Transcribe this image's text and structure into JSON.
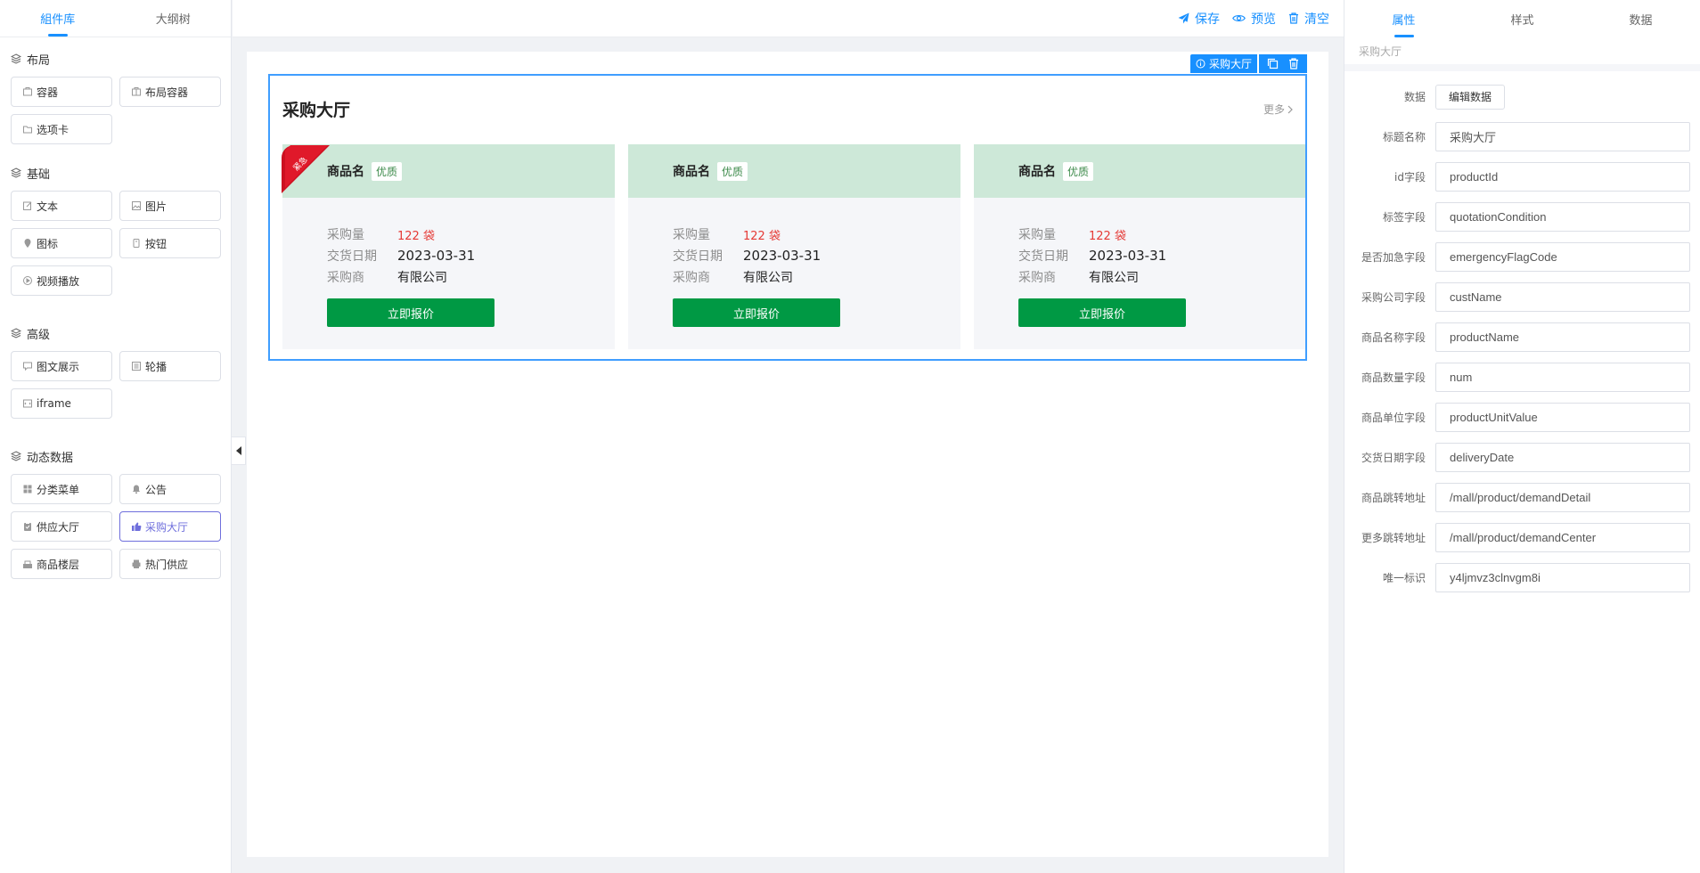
{
  "left_panel": {
    "tabs": [
      {
        "label": "組件库",
        "active": true
      },
      {
        "label": "大纲树",
        "active": false
      }
    ],
    "categories": [
      {
        "title": "布局",
        "items": [
          {
            "label": "容器",
            "icon": "container-icon"
          },
          {
            "label": "布局容器",
            "icon": "layout-container-icon"
          },
          {
            "label": "选项卡",
            "icon": "folder-icon"
          }
        ]
      },
      {
        "title": "基础",
        "items": [
          {
            "label": "文本",
            "icon": "edit-icon"
          },
          {
            "label": "图片",
            "icon": "picture-icon"
          },
          {
            "label": "图标",
            "icon": "location-icon"
          },
          {
            "label": "按钮",
            "icon": "button-icon"
          },
          {
            "label": "视频播放",
            "icon": "video-play-icon"
          }
        ]
      },
      {
        "title": "高级",
        "items": [
          {
            "label": "图文展示",
            "icon": "image-text-icon"
          },
          {
            "label": "轮播",
            "icon": "carousel-icon"
          },
          {
            "label": "iframe",
            "icon": "iframe-icon"
          }
        ]
      },
      {
        "title": "动态数据",
        "items": [
          {
            "label": "分类菜单",
            "icon": "grid-menu-icon"
          },
          {
            "label": "公告",
            "icon": "bell-icon"
          },
          {
            "label": "供应大厅",
            "icon": "clipboard-icon"
          },
          {
            "label": "采购大厅",
            "icon": "thumbs-up-icon",
            "selected": true
          },
          {
            "label": "商品楼层",
            "icon": "shop-floor-icon"
          },
          {
            "label": "热门供应",
            "icon": "printer-icon"
          }
        ]
      }
    ]
  },
  "toolbar": {
    "save_label": "保存",
    "preview_label": "预览",
    "clear_label": "清空"
  },
  "canvas": {
    "selected_tag": "采购大厅",
    "hall": {
      "title": "采购大厅",
      "more_label": "更多",
      "ribbon_text": "紧急",
      "cards": [
        {
          "name": "商品名",
          "tag": "优质",
          "qty_label": "采购量",
          "qty": "122 袋",
          "date_label": "交货日期",
          "date": "2023-03-31",
          "buyer_label": "采购商",
          "buyer": "有限公司",
          "button": "立即报价",
          "urgent": true
        },
        {
          "name": "商品名",
          "tag": "优质",
          "qty_label": "采购量",
          "qty": "122 袋",
          "date_label": "交货日期",
          "date": "2023-03-31",
          "buyer_label": "采购商",
          "buyer": "有限公司",
          "button": "立即报价",
          "urgent": false
        },
        {
          "name": "商品名",
          "tag": "优质",
          "qty_label": "采购量",
          "qty": "122 袋",
          "date_label": "交货日期",
          "date": "2023-03-31",
          "buyer_label": "采购商",
          "buyer": "有限公司",
          "button": "立即报价",
          "urgent": false
        }
      ]
    }
  },
  "right_panel": {
    "tabs": [
      {
        "label": "属性",
        "active": true
      },
      {
        "label": "样式",
        "active": false
      },
      {
        "label": "数据",
        "active": false
      }
    ],
    "subtitle": "采购大厅",
    "data_label": "数据",
    "edit_data_button": "编辑数据",
    "fields": [
      {
        "label": "标题名称",
        "value": "采购大厅"
      },
      {
        "label": "id字段",
        "value": "productId"
      },
      {
        "label": "标签字段",
        "value": "quotationCondition"
      },
      {
        "label": "是否加急字段",
        "value": "emergencyFlagCode"
      },
      {
        "label": "采购公司字段",
        "value": "custName"
      },
      {
        "label": "商品名称字段",
        "value": "productName"
      },
      {
        "label": "商品数量字段",
        "value": "num"
      },
      {
        "label": "商品单位字段",
        "value": "productUnitValue"
      },
      {
        "label": "交货日期字段",
        "value": "deliveryDate"
      },
      {
        "label": "商品跳转地址",
        "value": "/mall/product/demandDetail"
      },
      {
        "label": "更多跳转地址",
        "value": "/mall/product/demandCenter"
      },
      {
        "label": "唯一标识",
        "value": "y4ljmvz3clnvgm8i"
      }
    ]
  },
  "colors": {
    "primary": "#1890ff",
    "selected_component": "#6f6fdc",
    "card_head": "#cde8d8",
    "quote_button": "#009944",
    "quantity": "#e53935",
    "urgent_ribbon": "#d0021b"
  }
}
